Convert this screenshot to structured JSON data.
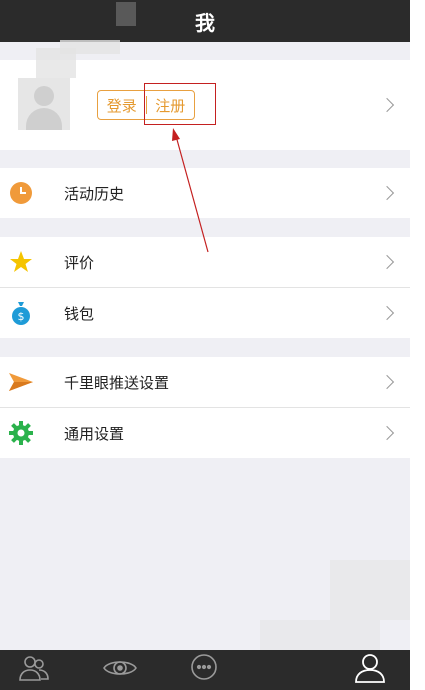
{
  "header": {
    "title": "我"
  },
  "profile": {
    "login_label": "登录",
    "register_label": "注册"
  },
  "menu": {
    "groups": [
      [
        {
          "label": "活动历史",
          "icon": "clock-icon"
        }
      ],
      [
        {
          "label": "评价",
          "icon": "star-icon"
        },
        {
          "label": "钱包",
          "icon": "money-bag-icon"
        }
      ],
      [
        {
          "label": "千里眼推送设置",
          "icon": "paper-plane-icon"
        },
        {
          "label": "通用设置",
          "icon": "gear-icon"
        }
      ]
    ]
  },
  "tabbar": {
    "tabs": [
      {
        "icon": "contacts-icon"
      },
      {
        "icon": "eye-icon"
      },
      {
        "icon": "chat-icon"
      },
      {
        "icon": "profile-icon"
      }
    ]
  },
  "colors": {
    "accent": "#e59a30",
    "dark_bar": "#2b2b2b",
    "background": "#efeff4",
    "annotation": "#c42020"
  }
}
